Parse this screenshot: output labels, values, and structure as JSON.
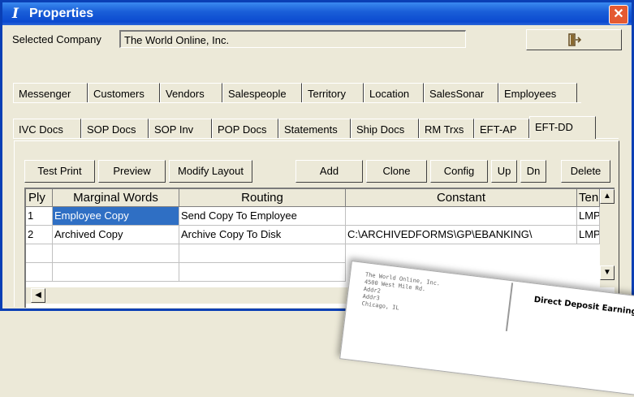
{
  "window": {
    "title": "Properties",
    "close_glyph": "✕"
  },
  "company": {
    "label": "Selected Company",
    "value": "The World Online, Inc.",
    "exit_icon": "exit-door-icon"
  },
  "tabs_row1": [
    "Messenger",
    "Customers",
    "Vendors",
    "Salespeople",
    "Territory",
    "Location",
    "SalesSonar",
    "Employees"
  ],
  "tabs_row2": [
    "IVC Docs",
    "SOP Docs",
    "SOP Inv",
    "POP Docs",
    "Statements",
    "Ship Docs",
    "RM Trxs",
    "EFT-AP",
    "EFT-DD"
  ],
  "selected_tab_row2": "EFT-DD",
  "toolbar": {
    "test_print": "Test Print",
    "preview": "Preview",
    "modify_layout": "Modify Layout",
    "add": "Add",
    "clone": "Clone",
    "config": "Config",
    "up": "Up",
    "dn": "Dn",
    "delete": "Delete"
  },
  "grid": {
    "columns": [
      "Ply",
      "Marginal Words",
      "Routing",
      "Constant",
      "Ten"
    ],
    "rows": [
      [
        "1",
        "Employee Copy",
        "Send Copy To Employee",
        "",
        "LMP"
      ],
      [
        "2",
        "Archived Copy",
        "Archive Copy To Disk",
        "C:\\ARCHIVEDFORMS\\GP\\EBANKING\\",
        "LMP"
      ]
    ]
  },
  "paper": {
    "title": "Direct Deposit Earnings",
    "header_lines": [
      "The World Online, Inc.",
      "4500 West Mile Rd.",
      "Addr2",
      "Addr3",
      "Chicago, IL"
    ]
  },
  "colors": {
    "title_bar": "#1a5fd8",
    "selection": "#2f6fc4",
    "close": "#e45a32"
  }
}
